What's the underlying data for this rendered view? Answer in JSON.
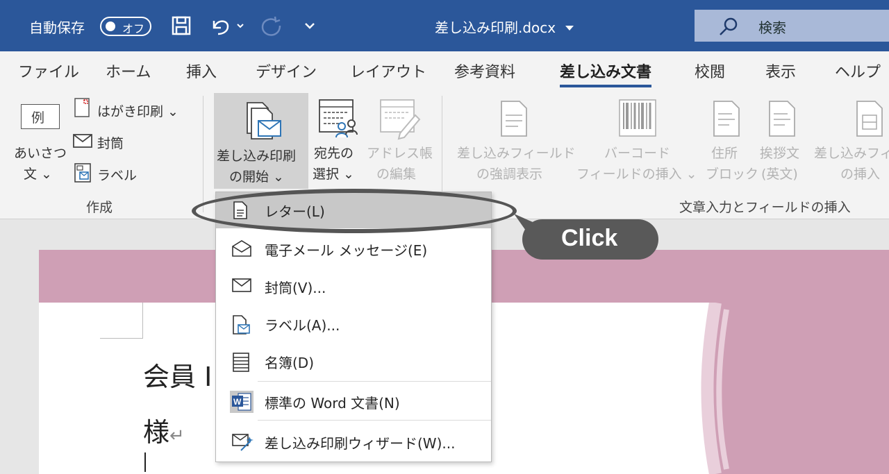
{
  "titlebar": {
    "autosave_label": "自動保存",
    "autosave_state": "オフ",
    "doc_title": "差し込み印刷.docx",
    "search_placeholder": "検索"
  },
  "tabs": [
    {
      "label": "ファイル"
    },
    {
      "label": "ホーム"
    },
    {
      "label": "挿入"
    },
    {
      "label": "デザイン"
    },
    {
      "label": "レイアウト"
    },
    {
      "label": "参考資料"
    },
    {
      "label": "差し込み文書",
      "active": true
    },
    {
      "label": "校閲"
    },
    {
      "label": "表示"
    },
    {
      "label": "ヘルプ"
    }
  ],
  "ribbon": {
    "create": {
      "group_label": "作成",
      "greeting_line1": "あいさつ",
      "greeting_line2": "文 ⌄",
      "example": "例",
      "postcard": "はがき印刷 ⌄",
      "envelope": "封筒",
      "label": "ラベル"
    },
    "start": {
      "start_line1": "差し込み印刷",
      "start_line2": "の開始 ⌄",
      "recipients_line1": "宛先の",
      "recipients_line2": "選択 ⌄",
      "addressbook_line1": "アドレス帳",
      "addressbook_line2": "の編集"
    },
    "fields": {
      "group_label": "文章入力とフィールドの挿入",
      "highlight_line1": "差し込みフィールド",
      "highlight_line2": "の強調表示",
      "barcode_line1": "バーコード",
      "barcode_line2": "フィールドの挿入 ⌄",
      "address_line1": "住所",
      "address_line2": "ブロック",
      "greeting_en_line1": "挨拶文",
      "greeting_en_line2": "(英文)",
      "insert_line1": "差し込みフィ",
      "insert_line2": "の挿入"
    }
  },
  "menu": {
    "items": [
      {
        "label": "レター(L)",
        "icon": "letter-icon"
      },
      {
        "label": "電子メール メッセージ(E)",
        "icon": "email-icon"
      },
      {
        "label": "封筒(V)...",
        "icon": "envelope-icon"
      },
      {
        "label": "ラベル(A)...",
        "icon": "label-icon"
      },
      {
        "label": "名簿(D)",
        "icon": "directory-icon"
      },
      {
        "label": "標準の Word 文書(N)",
        "icon": "word-doc-icon"
      },
      {
        "label": "差し込み印刷ウィザード(W)...",
        "icon": "wizard-icon"
      }
    ]
  },
  "document": {
    "line1": "会員 I",
    "line2": "様",
    "return_mark": "↵"
  },
  "annotation": {
    "callout": "Click"
  },
  "colors": {
    "titlebar": "#2b579a",
    "ribbon": "#f3f3f3",
    "doc_accent": "#cf9fb5",
    "callout": "#595959"
  }
}
